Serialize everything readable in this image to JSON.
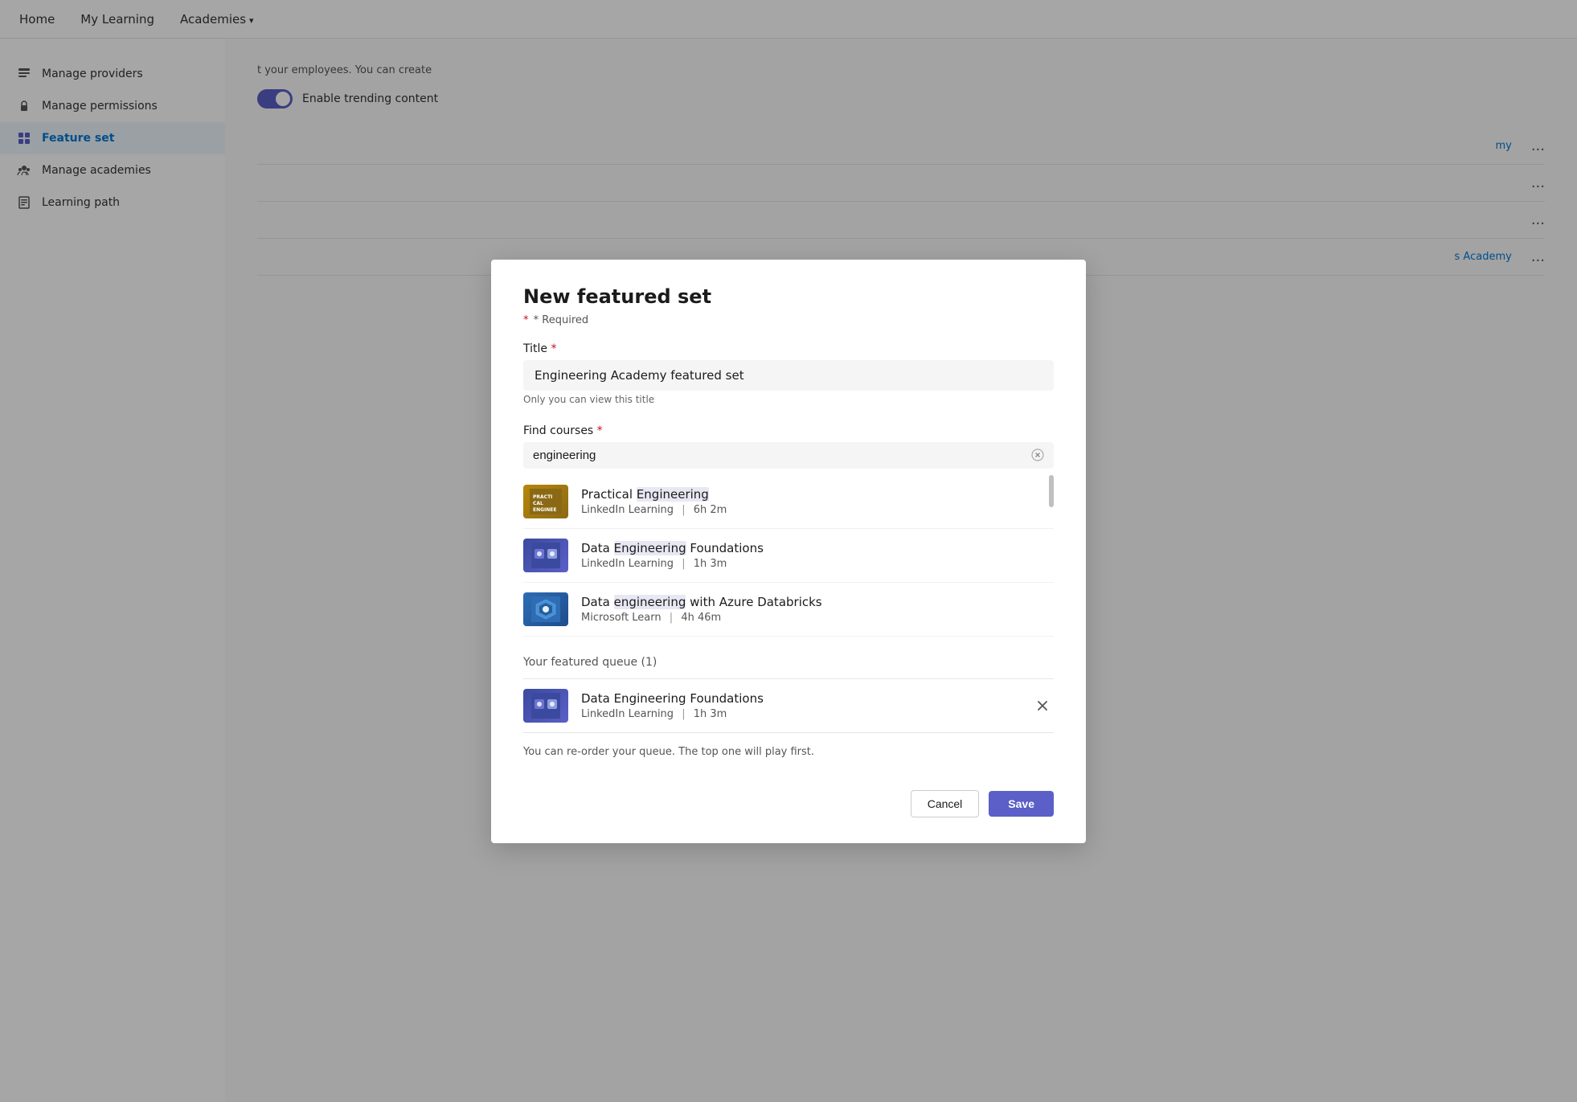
{
  "nav": {
    "items": [
      {
        "label": "Home"
      },
      {
        "label": "My Learning"
      },
      {
        "label": "Academies",
        "hasChevron": true
      }
    ]
  },
  "sidebar": {
    "items": [
      {
        "id": "manage-providers",
        "label": "Manage providers",
        "icon": "📋",
        "active": false
      },
      {
        "id": "manage-permissions",
        "label": "Manage permissions",
        "icon": "🔒",
        "active": false
      },
      {
        "id": "feature-set",
        "label": "Feature set",
        "icon": "📦",
        "active": true
      },
      {
        "id": "manage-academies",
        "label": "Manage academies",
        "icon": "👥",
        "active": false
      },
      {
        "id": "learning-path",
        "label": "Learning path",
        "icon": "📄",
        "active": false
      }
    ]
  },
  "background": {
    "header_text": "t your employees. You can create",
    "toggle_label": "Enable trending content",
    "rows": [
      {
        "link": "my",
        "dots": "..."
      },
      {
        "link": "",
        "dots": "..."
      },
      {
        "link": "",
        "dots": "..."
      },
      {
        "link": "s Academy",
        "dots": "..."
      }
    ]
  },
  "modal": {
    "title": "New featured set",
    "required_note": "* Required",
    "title_label": "Title",
    "title_value": "Engineering Academy featured set",
    "title_hint": "Only you can view this title",
    "find_courses_label": "Find courses",
    "search_value": "engineering",
    "search_placeholder": "engineering",
    "results": [
      {
        "id": "practical-engineering",
        "name": "Practical Engineering",
        "name_highlight": "Engineering",
        "provider": "LinkedIn Learning",
        "duration": "6h 2m",
        "thumbnail_type": "practical"
      },
      {
        "id": "data-engineering-foundations",
        "name": "Data Engineering Foundations",
        "name_highlight": "Engineering",
        "provider": "LinkedIn Learning",
        "duration": "1h 3m",
        "thumbnail_type": "data-eng"
      },
      {
        "id": "data-engineering-azure",
        "name": "Data engineering with Azure Databricks",
        "name_highlight": "engineering",
        "provider": "Microsoft Learn",
        "duration": "4h 46m",
        "thumbnail_type": "azure"
      }
    ],
    "queue_label": "Your featured queue (1)",
    "queue_items": [
      {
        "id": "queue-data-engineering-foundations",
        "name": "Data Engineering Foundations",
        "provider": "LinkedIn Learning",
        "duration": "1h 3m",
        "thumbnail_type": "data-eng"
      }
    ],
    "reorder_hint": "You can re-order your queue. The top one will play first.",
    "cancel_label": "Cancel",
    "save_label": "Save"
  }
}
